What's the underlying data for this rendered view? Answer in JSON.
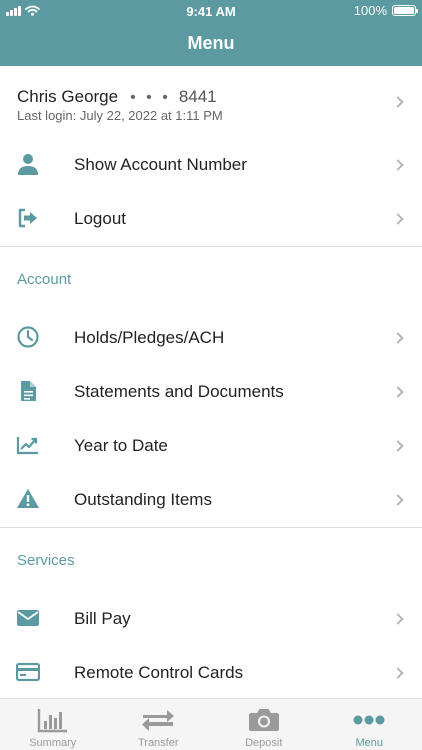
{
  "status_bar": {
    "time": "9:41 AM",
    "battery": "100%"
  },
  "header": {
    "title": "Menu"
  },
  "profile": {
    "name": "Chris George",
    "masked": "• • •",
    "account_suffix": "8441",
    "last_login": "Last login: July 22, 2022 at 1:11 PM"
  },
  "top_items": [
    {
      "label": "Show Account Number",
      "icon": "person-icon"
    },
    {
      "label": "Logout",
      "icon": "logout-icon"
    }
  ],
  "sections": {
    "account": {
      "title": "Account",
      "items": [
        {
          "label": "Holds/Pledges/ACH",
          "icon": "clock-icon"
        },
        {
          "label": "Statements and Documents",
          "icon": "document-icon"
        },
        {
          "label": "Year to Date",
          "icon": "trend-chart-icon"
        },
        {
          "label": "Outstanding Items",
          "icon": "warning-icon"
        }
      ]
    },
    "services": {
      "title": "Services",
      "items": [
        {
          "label": "Bill Pay",
          "icon": "envelope-icon"
        },
        {
          "label": "Remote Control Cards",
          "icon": "card-icon"
        }
      ]
    }
  },
  "tabs": [
    {
      "label": "Summary",
      "icon": "bar-chart-icon",
      "active": false
    },
    {
      "label": "Transfer",
      "icon": "transfer-arrows-icon",
      "active": false
    },
    {
      "label": "Deposit",
      "icon": "camera-icon",
      "active": false
    },
    {
      "label": "Menu",
      "icon": "more-dots-icon",
      "active": true
    }
  ],
  "colors": {
    "accent": "#5a9aa0",
    "inactive_tab": "#9a9a9a"
  }
}
